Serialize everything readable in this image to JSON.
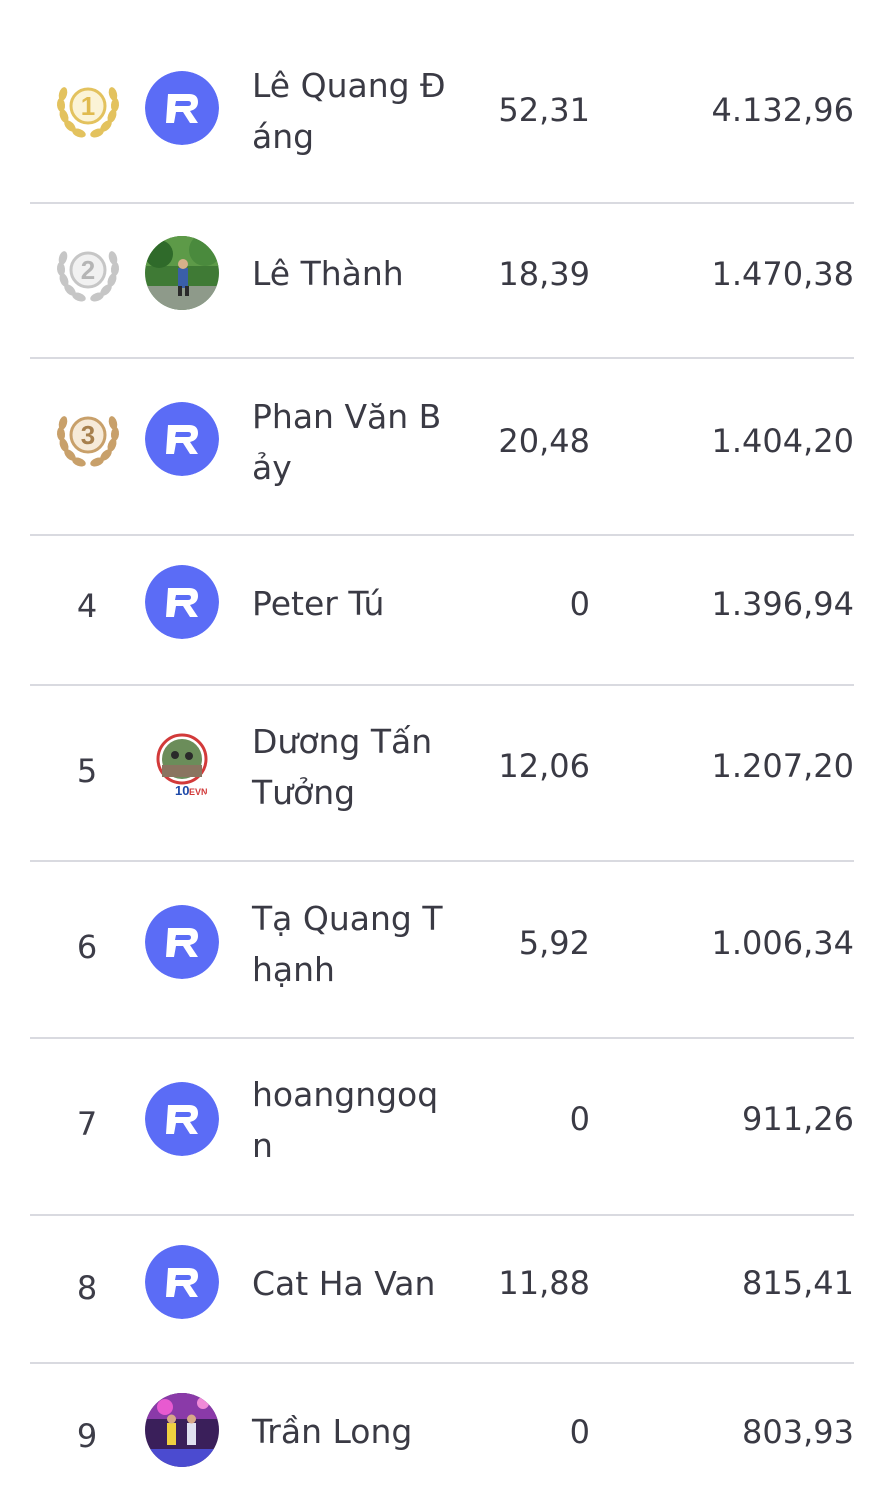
{
  "leaderboard": {
    "rows": [
      {
        "rank": "1",
        "name": "Lê Quang Đáng",
        "value1": "52,31",
        "value2": "4.132,96",
        "badge": "gold-medal-icon",
        "avatar": "app-logo-icon"
      },
      {
        "rank": "2",
        "name": "Lê Thành",
        "value1": "18,39",
        "value2": "1.470,38",
        "badge": "silver-medal-icon",
        "avatar": "photo-avatar"
      },
      {
        "rank": "3",
        "name": "Phan Văn Bảy",
        "value1": "20,48",
        "value2": "1.404,20",
        "badge": "bronze-medal-icon",
        "avatar": "app-logo-icon"
      },
      {
        "rank": "4",
        "name": "Peter Tú",
        "value1": "0",
        "value2": "1.396,94",
        "avatar": "app-logo-icon"
      },
      {
        "rank": "5",
        "name": "Dương Tấn Tưởng",
        "value1": "12,06",
        "value2": "1.207,20",
        "avatar": "photo-avatar"
      },
      {
        "rank": "6",
        "name": "Tạ Quang Thạnh",
        "value1": "5,92",
        "value2": "1.006,34",
        "avatar": "app-logo-icon"
      },
      {
        "rank": "7",
        "name": "hoangngoqn",
        "value1": "0",
        "value2": "911,26",
        "avatar": "app-logo-icon"
      },
      {
        "rank": "8",
        "name": "Cat Ha Van",
        "value1": "11,88",
        "value2": "815,41",
        "avatar": "app-logo-icon"
      },
      {
        "rank": "9",
        "name": "Trần Long",
        "value1": "0",
        "value2": "803,93",
        "avatar": "photo-avatar"
      }
    ]
  },
  "colors": {
    "accent": "#5b6cf6",
    "gold": "#e3c25e",
    "silver": "#c6c6c6",
    "bronze": "#c8a06a",
    "divider": "#d9dae0",
    "text": "#3a3a44"
  }
}
